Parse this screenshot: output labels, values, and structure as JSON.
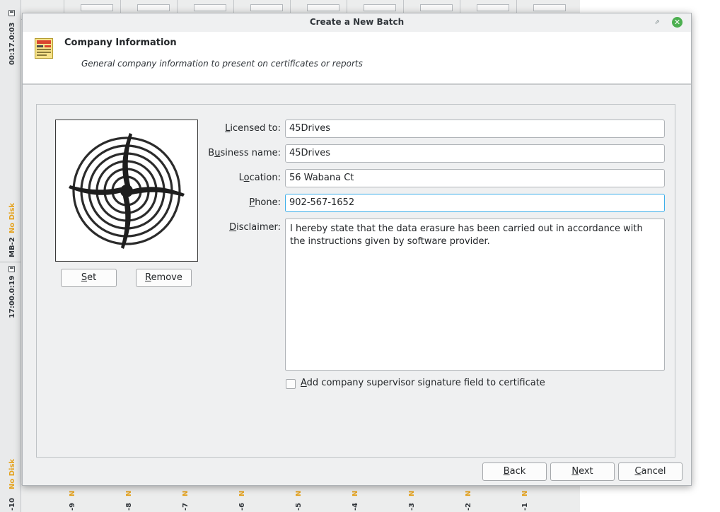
{
  "background": {
    "left_labels": [
      "00:17.0:03",
      "MB-2",
      "No Disk",
      "17:00.0:19",
      "No Disk",
      "-10"
    ],
    "bottom_labels": [
      "-9",
      "-8",
      "-7",
      "-6",
      "-5",
      "-4",
      "-3",
      "-2",
      "-1"
    ],
    "bottom_status_letter": "N"
  },
  "dialog": {
    "title": "Create a New Batch",
    "header": {
      "title": "Company Information",
      "subtitle": "General company information to present on certificates or reports"
    },
    "logo": {
      "set_label_mnemonic": "S",
      "set_label_rest": "et",
      "remove_label_mnemonic": "R",
      "remove_label_rest": "emove"
    },
    "fields": {
      "licensed_to": {
        "label_mnemonic": "L",
        "label_rest": "icensed to:",
        "value": "45Drives"
      },
      "business_name": {
        "label_pre": "B",
        "label_mnemonic": "u",
        "label_rest": "siness name:",
        "value": "45Drives"
      },
      "location": {
        "label_pre": "L",
        "label_mnemonic": "o",
        "label_rest": "cation:",
        "value": "56 Wabana Ct"
      },
      "phone": {
        "label_mnemonic": "P",
        "label_rest": "hone:",
        "value": "902-567-1652"
      },
      "disclaimer": {
        "label_mnemonic": "D",
        "label_rest": "isclaimer:",
        "value": "I hereby state that the data erasure has been carried out in accordance with the instructions given by software provider."
      }
    },
    "signature_checkbox": {
      "label_mnemonic": "A",
      "label_rest": "dd company supervisor signature field to certificate",
      "checked": false
    },
    "buttons": {
      "back_mnemonic": "B",
      "back_rest": "ack",
      "next_mnemonic": "N",
      "next_rest": "ext",
      "cancel_mnemonic": "C",
      "cancel_rest": "ancel"
    }
  }
}
